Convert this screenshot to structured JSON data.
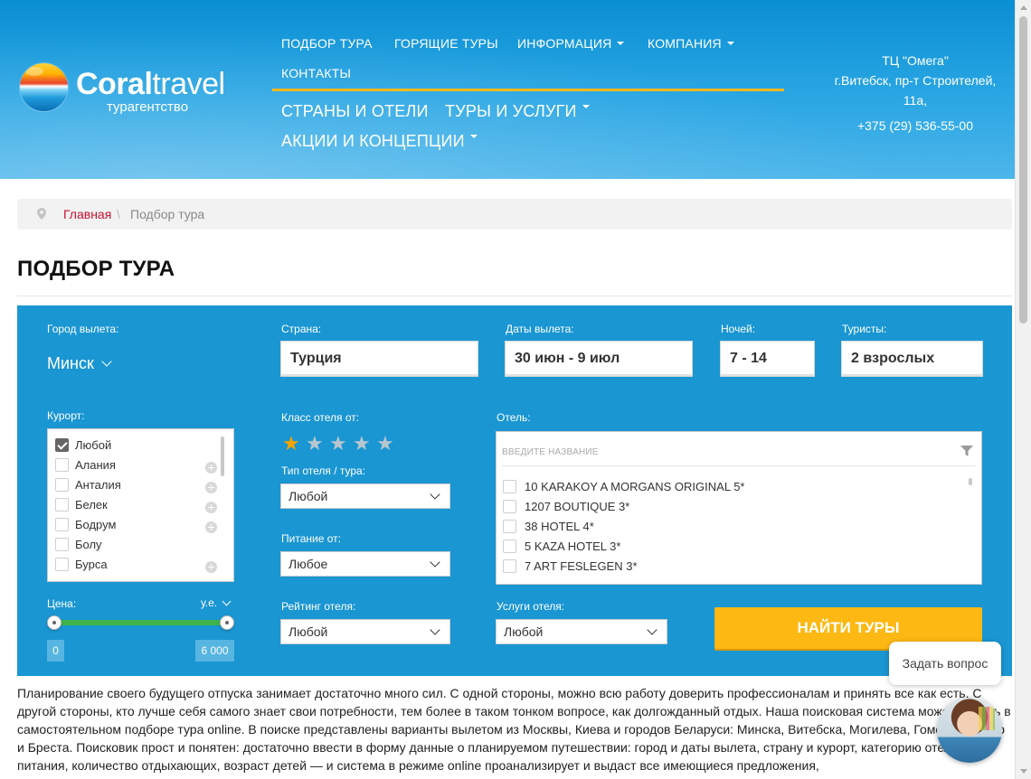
{
  "header": {
    "logo": {
      "main_bold": "Coral",
      "main_light": "travel",
      "sub": "турагентство"
    },
    "top_nav": [
      {
        "label": "ПОДБОР ТУРА",
        "dropdown": false
      },
      {
        "label": "ГОРЯЩИЕ ТУРЫ",
        "dropdown": false
      },
      {
        "label": "ИНФОРМАЦИЯ",
        "dropdown": true
      },
      {
        "label": "КОМПАНИЯ",
        "dropdown": true
      },
      {
        "label": "КОНТАКТЫ",
        "dropdown": false
      }
    ],
    "main_nav": [
      {
        "label": "СТРАНЫ И ОТЕЛИ",
        "dropdown": false
      },
      {
        "label": "ТУРЫ И УСЛУГИ",
        "dropdown": true
      },
      {
        "label": "АКЦИИ И КОНЦЕПЦИИ",
        "dropdown": true
      }
    ],
    "contact": {
      "name": "ТЦ \"Омега\"",
      "address_line1": "г.Витебск, пр-т Строителей,",
      "address_line2": "11а,",
      "phone": "+375 (29) 536-55-00"
    },
    "colors": {
      "header_bg": "#1a9ad9",
      "nav_underline": "#f5b81e"
    }
  },
  "breadcrumb": {
    "home": "Главная",
    "separator": "\\",
    "current": "Подбор тура"
  },
  "page_title": "ПОДБОР ТУРА",
  "search": {
    "departure_city": {
      "label": "Город вылета:",
      "value": "Минск"
    },
    "country": {
      "label": "Страна:",
      "value": "Турция"
    },
    "dates": {
      "label": "Даты вылета:",
      "value": "30 июн - 9 июл"
    },
    "nights": {
      "label": "Ночей:",
      "value": "7 - 14"
    },
    "tourists": {
      "label": "Туристы:",
      "value": "2 взрослых"
    },
    "resort": {
      "label": "Курорт:",
      "items": [
        {
          "label": "Любой",
          "checked": true,
          "expandable": false
        },
        {
          "label": "Алания",
          "checked": false,
          "expandable": true
        },
        {
          "label": "Анталия",
          "checked": false,
          "expandable": true
        },
        {
          "label": "Белек",
          "checked": false,
          "expandable": true
        },
        {
          "label": "Бодрум",
          "checked": false,
          "expandable": true
        },
        {
          "label": "Болу",
          "checked": false,
          "expandable": false
        },
        {
          "label": "Бурса",
          "checked": false,
          "expandable": true
        }
      ]
    },
    "hotel_class": {
      "label": "Класс отеля от:",
      "stars_total": 5,
      "stars_selected": 1
    },
    "hotel_type": {
      "label": "Тип отеля / тура:",
      "value": "Любой"
    },
    "meal": {
      "label": "Питание от:",
      "value": "Любое"
    },
    "rating": {
      "label": "Рейтинг отеля:",
      "value": "Любой"
    },
    "services": {
      "label": "Услуги отеля:",
      "value": "Любой"
    },
    "hotel": {
      "label": "Отель:",
      "placeholder": "ВВЕДИТЕ НАЗВАНИЕ",
      "items": [
        "10 KARAKOY A MORGANS ORIGINAL 5*",
        "1207 BOUTIQUE 3*",
        "38 HOTEL 4*",
        "5 KAZA HOTEL 3*",
        "7 ART FESLEGEN 3*"
      ]
    },
    "price": {
      "label": "Цена:",
      "currency": "у.е.",
      "min": "0",
      "max": "6 000"
    },
    "submit": "НАЙТИ ТУРЫ",
    "colors": {
      "panel_bg": "#1a96d2",
      "button_bg": "#fdb813",
      "slider": "#3fb44b",
      "star_on": "#f5a300"
    }
  },
  "intro_text": "Планирование своего будущего отпуска занимает достаточно много сил. С одной стороны, можно всю работу доверить профессионалам и принять все как есть. С другой стороны, кто лучше себя самого знает свои потребности, тем более в таком тонком вопросе, как долгожданный отдых. Наша поисковая система может помочь в самостоятельном подборе тура online. В поиске представлены варианты вылетом из Москвы, Киева и городов Беларуси: Минска, Витебска, Могилева, Гомеля, Гродно и Бреста. Поисковик прост и понятен: достаточно ввести в форму данные о планируемом путешествии: город и даты вылета, страну и курорт, категорию отеля и тип питания, количество отдыхающих, возраст детей — и система в режиме online проанализирует и выдаст все имеющиеся предложения,",
  "chat": {
    "ask_label": "Задать вопрос"
  }
}
